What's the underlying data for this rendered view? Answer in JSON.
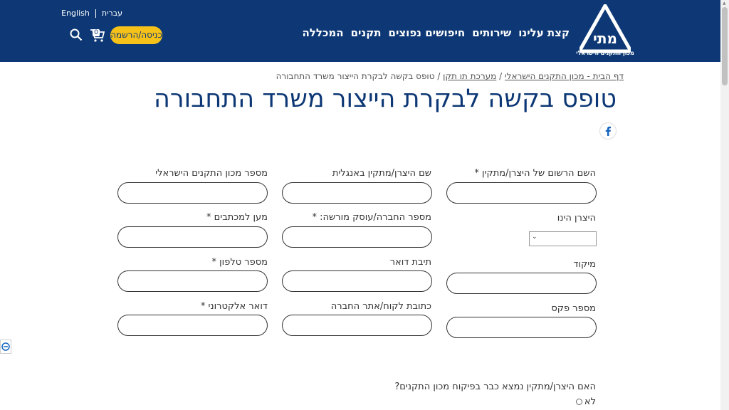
{
  "header": {
    "logo_alt": "מתי",
    "logo_subtitle": "מכון התקנים הישראלי",
    "nav": [
      "קצת עלינו",
      "שירותים",
      "חיפושים נפוצים",
      "תקנים",
      "המכללה"
    ],
    "lang": {
      "hebrew": "עברית",
      "english": "English"
    },
    "login_label": "כניסה/הרשמה",
    "cart_count": "0",
    "colors": {
      "brand": "#0d3875",
      "accent": "#f6c21a"
    }
  },
  "breadcrumb": {
    "home": "דף הבית - מכון התקנים הישראלי",
    "sep1": " / ",
    "section": "מערכת תו תקן",
    "sep2": " / ",
    "current": "טופס בקשה לבקרת הייצור משרד התחבורה"
  },
  "title": "טופס בקשה לבקרת הייצור משרד התחבורה",
  "form": {
    "row1": {
      "col1": "השם הרשום של היצרן/מתקין *",
      "col2": "שם היצרן/מתקין באנגלית",
      "col3": "מספר מכון התקנים הישראלי"
    },
    "row2": {
      "col1": "היצרן הינו",
      "col2": "מספר החברה/עוסק מורשה: *",
      "col3": "מען למכתבים *"
    },
    "row3": {
      "col1": "מיקוד",
      "col2": "תיבת דואר",
      "col3": "מספר טלפון *"
    },
    "row4": {
      "col1": "מספר פקס",
      "col2": "כתובת לקוח/אתר החברה",
      "col3": "דואר אלקטרוני *"
    },
    "question": "האם היצרן/מתקין נמצא כבר בפיקוח מכון התקנים?",
    "option_no": "לא"
  }
}
